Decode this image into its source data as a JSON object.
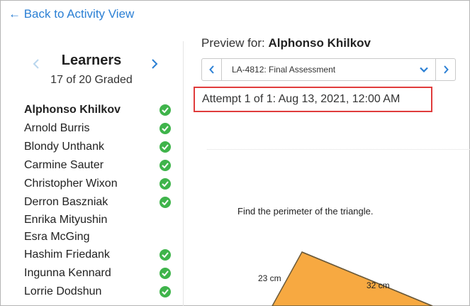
{
  "nav": {
    "back_label": "← Back to Activity View"
  },
  "learners": {
    "title": "Learners",
    "graded_count": "17 of 20 Graded",
    "items": [
      {
        "name": "Alphonso Khilkov",
        "graded": true,
        "active": true
      },
      {
        "name": "Arnold Burris",
        "graded": true,
        "active": false
      },
      {
        "name": "Blondy Unthank",
        "graded": true,
        "active": false
      },
      {
        "name": "Carmine Sauter",
        "graded": true,
        "active": false
      },
      {
        "name": "Christopher Wixon",
        "graded": true,
        "active": false
      },
      {
        "name": "Derron Baszniak",
        "graded": true,
        "active": false
      },
      {
        "name": "Enrika Mityushin",
        "graded": false,
        "active": false
      },
      {
        "name": "Esra McGing",
        "graded": false,
        "active": false
      },
      {
        "name": "Hashim Friedank",
        "graded": true,
        "active": false
      },
      {
        "name": "Ingunna Kennard",
        "graded": true,
        "active": false
      },
      {
        "name": "Lorrie Dodshun",
        "graded": true,
        "active": false
      }
    ]
  },
  "preview": {
    "label": "Preview for: ",
    "learner_name": "Alphonso Khilkov",
    "assessment": "LA-4812: Final Assessment",
    "attempt": "Attempt 1 of 1: Aug 13, 2021, 12:00 AM"
  },
  "question": {
    "text": "Find the perimeter of the triangle.",
    "side_a": "23 cm",
    "side_b": "32 cm"
  },
  "colors": {
    "accent": "#2a7fd4",
    "check": "#3fb44b",
    "highlight": "#e03c3c",
    "triangle_fill": "#f7a941"
  }
}
